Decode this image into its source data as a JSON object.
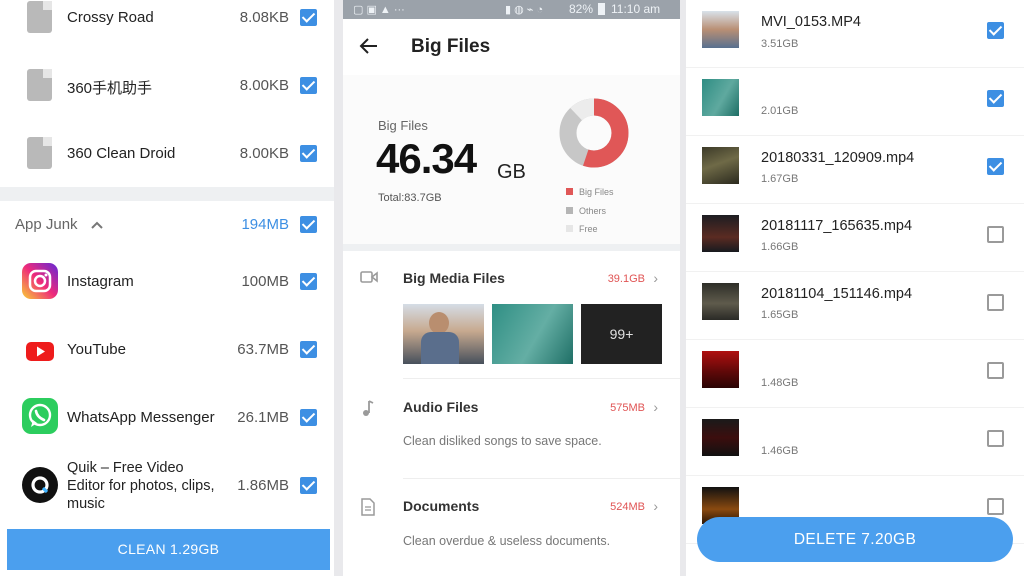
{
  "left": {
    "files": [
      {
        "name": "Crossy Road",
        "size": "8.08KB"
      },
      {
        "name": "360手机助手",
        "size": "8.00KB"
      },
      {
        "name": "360 Clean Droid",
        "size": "8.00KB"
      }
    ],
    "app_junk": {
      "label": "App Junk",
      "size": "194MB"
    },
    "apps": [
      {
        "name": "Instagram",
        "size": "100MB",
        "icon": "instagram-icon"
      },
      {
        "name": "YouTube",
        "size": "63.7MB",
        "icon": "youtube-icon"
      },
      {
        "name": "WhatsApp Messenger",
        "size": "26.1MB",
        "icon": "whatsapp-icon"
      },
      {
        "name_lines": [
          "Quik – Free Video",
          "Editor for photos, clips,",
          "music"
        ],
        "size": "1.86MB",
        "icon": "quik-icon"
      }
    ],
    "clean_label": "CLEAN 1.29GB"
  },
  "middle": {
    "status": {
      "battery": "82%",
      "time": "11:10 am"
    },
    "title": "Big Files",
    "summary": {
      "label": "Big Files",
      "value": "46.34",
      "unit": "GB",
      "total": "Total:83.7GB",
      "legend": [
        "Big Files",
        "Others",
        "Free"
      ]
    },
    "categories": [
      {
        "name": "Big Media Files",
        "size": "39.1GB"
      },
      {
        "name": "Audio Files",
        "size": "575MB",
        "desc": "Clean disliked songs to save space."
      },
      {
        "name": "Documents",
        "size": "524MB",
        "desc": "Clean overdue & useless documents."
      }
    ],
    "more_count": "99+"
  },
  "right": {
    "files": [
      {
        "name": "MVI_0153.MP4",
        "size": "3.51GB",
        "checked": true
      },
      {
        "name": "",
        "size": "2.01GB",
        "checked": true
      },
      {
        "name": "20180331_120909.mp4",
        "size": "1.67GB",
        "checked": true
      },
      {
        "name": "20181117_165635.mp4",
        "size": "1.66GB",
        "checked": false
      },
      {
        "name": "20181104_151146.mp4",
        "size": "1.65GB",
        "checked": false
      },
      {
        "name": "",
        "size": "1.48GB",
        "checked": false
      },
      {
        "name": "",
        "size": "1.46GB",
        "checked": false
      }
    ],
    "delete_label": "DELETE 7.20GB"
  },
  "colors": {
    "accent": "#4b9fee",
    "checkbox": "#3d8fe3",
    "danger": "#e05454",
    "donut_big": "#e05757",
    "donut_others": "#c7c7c7",
    "donut_free": "#ececec"
  }
}
